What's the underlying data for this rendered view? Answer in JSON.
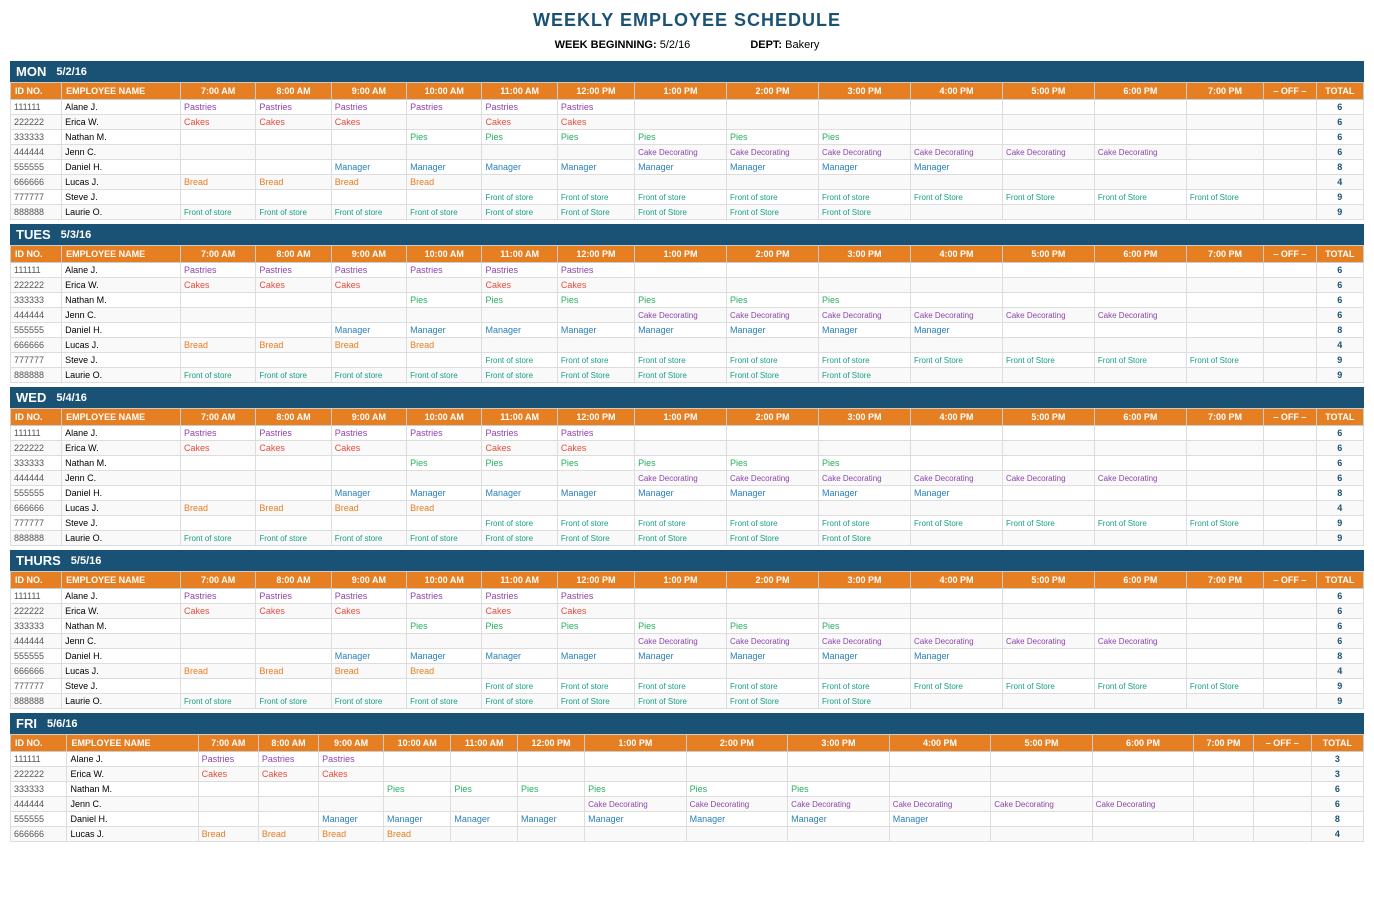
{
  "title": "WEEKLY EMPLOYEE SCHEDULE",
  "meta": {
    "week_label": "WEEK BEGINNING:",
    "week_value": "5/2/16",
    "dept_label": "DEPT:",
    "dept_value": "Bakery"
  },
  "time_headers": [
    "7:00 AM",
    "8:00 AM",
    "9:00 AM",
    "10:00 AM",
    "11:00 AM",
    "12:00 PM",
    "1:00 PM",
    "2:00 PM",
    "3:00 PM",
    "4:00 PM",
    "5:00 PM",
    "6:00 PM",
    "7:00 PM",
    "– OFF –",
    "TOTAL"
  ],
  "days": [
    {
      "day": "MON",
      "date": "5/2/16",
      "employees": [
        {
          "id": "111111",
          "name": "Alane J.",
          "slots": [
            "Pastries",
            "Pastries",
            "Pastries",
            "Pastries",
            "Pastries",
            "Pastries",
            "",
            "",
            "",
            "",
            "",
            "",
            ""
          ],
          "off": "",
          "total": 6
        },
        {
          "id": "222222",
          "name": "Erica W.",
          "slots": [
            "Cakes",
            "Cakes",
            "Cakes",
            "",
            "Cakes",
            "Cakes",
            "",
            "",
            "",
            "",
            "",
            "",
            ""
          ],
          "off": "",
          "total": 6
        },
        {
          "id": "333333",
          "name": "Nathan M.",
          "slots": [
            "",
            "",
            "",
            "Pies",
            "Pies",
            "Pies",
            "Pies",
            "Pies",
            "Pies",
            "",
            "",
            "",
            ""
          ],
          "off": "",
          "total": 6
        },
        {
          "id": "444444",
          "name": "Jenn C.",
          "slots": [
            "",
            "",
            "",
            "",
            "",
            "",
            "Cake Decorating",
            "Cake Decorating",
            "Cake Decorating",
            "Cake Decorating",
            "Cake Decorating",
            "Cake Decorating",
            ""
          ],
          "off": "",
          "total": 6
        },
        {
          "id": "555555",
          "name": "Daniel H.",
          "slots": [
            "",
            "",
            "Manager",
            "Manager",
            "Manager",
            "Manager",
            "Manager",
            "Manager",
            "Manager",
            "Manager",
            "",
            "",
            ""
          ],
          "off": "",
          "total": 8
        },
        {
          "id": "666666",
          "name": "Lucas J.",
          "slots": [
            "Bread",
            "Bread",
            "Bread",
            "Bread",
            "",
            "",
            "",
            "",
            "",
            "",
            "",
            "",
            ""
          ],
          "off": "",
          "total": 4
        },
        {
          "id": "777777",
          "name": "Steve J.",
          "slots": [
            "",
            "",
            "",
            "",
            "Front of store",
            "Front of store",
            "Front of store",
            "Front of store",
            "Front of store",
            "Front of Store",
            "Front of Store",
            "Front of Store",
            "Front of Store"
          ],
          "off": "",
          "total": 9
        },
        {
          "id": "888888",
          "name": "Laurie O.",
          "slots": [
            "Front of store",
            "Front of store",
            "Front of store",
            "Front of store",
            "Front of store",
            "Front of Store",
            "Front of Store",
            "Front of Store",
            "Front of Store",
            "",
            "",
            "",
            ""
          ],
          "off": "",
          "total": 9
        }
      ]
    },
    {
      "day": "TUES",
      "date": "5/3/16",
      "employees": [
        {
          "id": "111111",
          "name": "Alane J.",
          "slots": [
            "Pastries",
            "Pastries",
            "Pastries",
            "Pastries",
            "Pastries",
            "Pastries",
            "",
            "",
            "",
            "",
            "",
            "",
            ""
          ],
          "off": "",
          "total": 6
        },
        {
          "id": "222222",
          "name": "Erica W.",
          "slots": [
            "Cakes",
            "Cakes",
            "Cakes",
            "",
            "Cakes",
            "Cakes",
            "",
            "",
            "",
            "",
            "",
            "",
            ""
          ],
          "off": "",
          "total": 6
        },
        {
          "id": "333333",
          "name": "Nathan M.",
          "slots": [
            "",
            "",
            "",
            "Pies",
            "Pies",
            "Pies",
            "Pies",
            "Pies",
            "Pies",
            "",
            "",
            "",
            ""
          ],
          "off": "",
          "total": 6
        },
        {
          "id": "444444",
          "name": "Jenn C.",
          "slots": [
            "",
            "",
            "",
            "",
            "",
            "",
            "Cake Decorating",
            "Cake Decorating",
            "Cake Decorating",
            "Cake Decorating",
            "Cake Decorating",
            "Cake Decorating",
            ""
          ],
          "off": "",
          "total": 6
        },
        {
          "id": "555555",
          "name": "Daniel H.",
          "slots": [
            "",
            "",
            "Manager",
            "Manager",
            "Manager",
            "Manager",
            "Manager",
            "Manager",
            "Manager",
            "Manager",
            "",
            "",
            ""
          ],
          "off": "",
          "total": 8
        },
        {
          "id": "666666",
          "name": "Lucas J.",
          "slots": [
            "Bread",
            "Bread",
            "Bread",
            "Bread",
            "",
            "",
            "",
            "",
            "",
            "",
            "",
            "",
            ""
          ],
          "off": "",
          "total": 4
        },
        {
          "id": "777777",
          "name": "Steve J.",
          "slots": [
            "",
            "",
            "",
            "",
            "Front of store",
            "Front of store",
            "Front of store",
            "Front of store",
            "Front of store",
            "Front of Store",
            "Front of Store",
            "Front of Store",
            "Front of Store"
          ],
          "off": "",
          "total": 9
        },
        {
          "id": "888888",
          "name": "Laurie O.",
          "slots": [
            "Front of store",
            "Front of store",
            "Front of store",
            "Front of store",
            "Front of store",
            "Front of Store",
            "Front of Store",
            "Front of Store",
            "Front of Store",
            "",
            "",
            "",
            ""
          ],
          "off": "",
          "total": 9
        }
      ]
    },
    {
      "day": "WED",
      "date": "5/4/16",
      "employees": [
        {
          "id": "111111",
          "name": "Alane J.",
          "slots": [
            "Pastries",
            "Pastries",
            "Pastries",
            "Pastries",
            "Pastries",
            "Pastries",
            "",
            "",
            "",
            "",
            "",
            "",
            ""
          ],
          "off": "",
          "total": 6
        },
        {
          "id": "222222",
          "name": "Erica W.",
          "slots": [
            "Cakes",
            "Cakes",
            "Cakes",
            "",
            "Cakes",
            "Cakes",
            "",
            "",
            "",
            "",
            "",
            "",
            ""
          ],
          "off": "",
          "total": 6
        },
        {
          "id": "333333",
          "name": "Nathan M.",
          "slots": [
            "",
            "",
            "",
            "Pies",
            "Pies",
            "Pies",
            "Pies",
            "Pies",
            "Pies",
            "",
            "",
            "",
            ""
          ],
          "off": "",
          "total": 6
        },
        {
          "id": "444444",
          "name": "Jenn C.",
          "slots": [
            "",
            "",
            "",
            "",
            "",
            "",
            "Cake Decorating",
            "Cake Decorating",
            "Cake Decorating",
            "Cake Decorating",
            "Cake Decorating",
            "Cake Decorating",
            ""
          ],
          "off": "",
          "total": 6
        },
        {
          "id": "555555",
          "name": "Daniel H.",
          "slots": [
            "",
            "",
            "Manager",
            "Manager",
            "Manager",
            "Manager",
            "Manager",
            "Manager",
            "Manager",
            "Manager",
            "",
            "",
            ""
          ],
          "off": "",
          "total": 8
        },
        {
          "id": "666666",
          "name": "Lucas J.",
          "slots": [
            "Bread",
            "Bread",
            "Bread",
            "Bread",
            "",
            "",
            "",
            "",
            "",
            "",
            "",
            "",
            ""
          ],
          "off": "",
          "total": 4
        },
        {
          "id": "777777",
          "name": "Steve J.",
          "slots": [
            "",
            "",
            "",
            "",
            "Front of store",
            "Front of store",
            "Front of store",
            "Front of store",
            "Front of store",
            "Front of Store",
            "Front of Store",
            "Front of Store",
            "Front of Store"
          ],
          "off": "",
          "total": 9
        },
        {
          "id": "888888",
          "name": "Laurie O.",
          "slots": [
            "Front of store",
            "Front of store",
            "Front of store",
            "Front of store",
            "Front of store",
            "Front of Store",
            "Front of Store",
            "Front of Store",
            "Front of Store",
            "",
            "",
            "",
            ""
          ],
          "off": "",
          "total": 9
        }
      ]
    },
    {
      "day": "THURS",
      "date": "5/5/16",
      "employees": [
        {
          "id": "111111",
          "name": "Alane J.",
          "slots": [
            "Pastries",
            "Pastries",
            "Pastries",
            "Pastries",
            "Pastries",
            "Pastries",
            "",
            "",
            "",
            "",
            "",
            "",
            ""
          ],
          "off": "",
          "total": 6
        },
        {
          "id": "222222",
          "name": "Erica W.",
          "slots": [
            "Cakes",
            "Cakes",
            "Cakes",
            "",
            "Cakes",
            "Cakes",
            "",
            "",
            "",
            "",
            "",
            "",
            ""
          ],
          "off": "",
          "total": 6
        },
        {
          "id": "333333",
          "name": "Nathan M.",
          "slots": [
            "",
            "",
            "",
            "Pies",
            "Pies",
            "Pies",
            "Pies",
            "Pies",
            "Pies",
            "",
            "",
            "",
            ""
          ],
          "off": "",
          "total": 6
        },
        {
          "id": "444444",
          "name": "Jenn C.",
          "slots": [
            "",
            "",
            "",
            "",
            "",
            "",
            "Cake Decorating",
            "Cake Decorating",
            "Cake Decorating",
            "Cake Decorating",
            "Cake Decorating",
            "Cake Decorating",
            ""
          ],
          "off": "",
          "total": 6
        },
        {
          "id": "555555",
          "name": "Daniel H.",
          "slots": [
            "",
            "",
            "Manager",
            "Manager",
            "Manager",
            "Manager",
            "Manager",
            "Manager",
            "Manager",
            "Manager",
            "",
            "",
            ""
          ],
          "off": "",
          "total": 8
        },
        {
          "id": "666666",
          "name": "Lucas J.",
          "slots": [
            "Bread",
            "Bread",
            "Bread",
            "Bread",
            "",
            "",
            "",
            "",
            "",
            "",
            "",
            "",
            ""
          ],
          "off": "",
          "total": 4
        },
        {
          "id": "777777",
          "name": "Steve J.",
          "slots": [
            "",
            "",
            "",
            "",
            "Front of store",
            "Front of store",
            "Front of store",
            "Front of store",
            "Front of store",
            "Front of Store",
            "Front of Store",
            "Front of Store",
            "Front of Store"
          ],
          "off": "",
          "total": 9
        },
        {
          "id": "888888",
          "name": "Laurie O.",
          "slots": [
            "Front of store",
            "Front of store",
            "Front of store",
            "Front of store",
            "Front of store",
            "Front of Store",
            "Front of Store",
            "Front of Store",
            "Front of Store",
            "",
            "",
            "",
            ""
          ],
          "off": "",
          "total": 9
        }
      ]
    },
    {
      "day": "FRI",
      "date": "5/6/16",
      "employees": [
        {
          "id": "111111",
          "name": "Alane J.",
          "slots": [
            "Pastries",
            "Pastries",
            "Pastries",
            "",
            "",
            "",
            "",
            "",
            "",
            "",
            "",
            "",
            ""
          ],
          "off": "",
          "total": 3
        },
        {
          "id": "222222",
          "name": "Erica W.",
          "slots": [
            "Cakes",
            "Cakes",
            "Cakes",
            "",
            "",
            "",
            "",
            "",
            "",
            "",
            "",
            "",
            ""
          ],
          "off": "",
          "total": 3
        },
        {
          "id": "333333",
          "name": "Nathan M.",
          "slots": [
            "",
            "",
            "",
            "Pies",
            "Pies",
            "Pies",
            "Pies",
            "Pies",
            "Pies",
            "",
            "",
            "",
            ""
          ],
          "off": "",
          "total": 6
        },
        {
          "id": "444444",
          "name": "Jenn C.",
          "slots": [
            "",
            "",
            "",
            "",
            "",
            "",
            "Cake Decorating",
            "Cake Decorating",
            "Cake Decorating",
            "Cake Decorating",
            "Cake Decorating",
            "Cake Decorating",
            ""
          ],
          "off": "",
          "total": 6
        },
        {
          "id": "555555",
          "name": "Daniel H.",
          "slots": [
            "",
            "",
            "Manager",
            "Manager",
            "Manager",
            "Manager",
            "Manager",
            "Manager",
            "Manager",
            "Manager",
            "",
            "",
            ""
          ],
          "off": "",
          "total": 8
        },
        {
          "id": "666666",
          "name": "Lucas J.",
          "slots": [
            "Bread",
            "Bread",
            "Bread",
            "Bread",
            "",
            "",
            "",
            "",
            "",
            "",
            "",
            "",
            ""
          ],
          "off": "",
          "total": 4
        }
      ]
    }
  ],
  "col_headers": {
    "id": "ID NO.",
    "name": "EMPLOYEE NAME",
    "off": "– OFF –",
    "total": "TOTAL"
  }
}
